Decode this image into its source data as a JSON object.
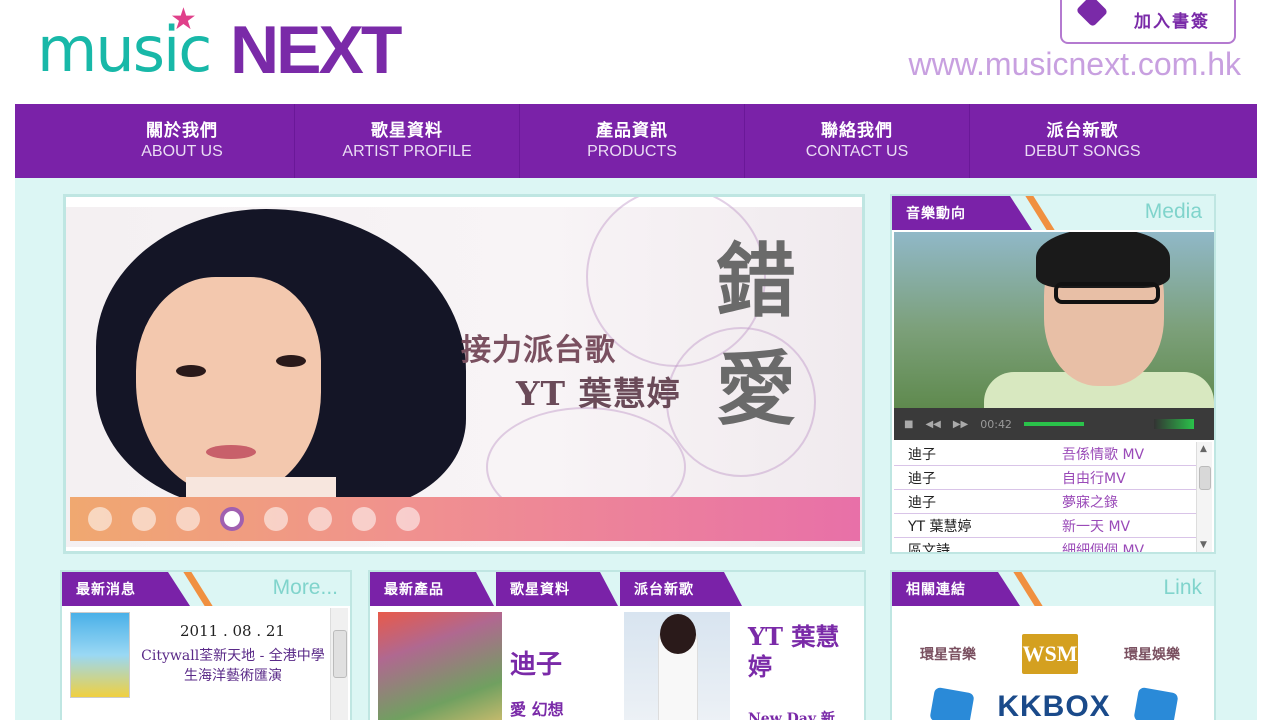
{
  "header": {
    "logo_music": "music",
    "logo_next": "NEXT",
    "bookmark_label": "加入書簽",
    "url": "www.musicnext.com.hk"
  },
  "nav": [
    {
      "zh": "關於我們",
      "en": "ABOUT US"
    },
    {
      "zh": "歌星資料",
      "en": "ARTIST PROFILE"
    },
    {
      "zh": "產品資訊",
      "en": "PRODUCTS"
    },
    {
      "zh": "聯絡我們",
      "en": "CONTACT US"
    },
    {
      "zh": "派台新歌",
      "en": "DEBUT SONGS"
    }
  ],
  "banner": {
    "line1": "接力派台歌",
    "line2": "YT 葉慧婷",
    "title": "錯愛",
    "slide_count": 8,
    "active_slide": 4
  },
  "media": {
    "tab": "音樂動向",
    "en": "Media",
    "player_time": "00:42",
    "playlist": [
      {
        "artist": "迪子",
        "song": "吾係情歌 MV"
      },
      {
        "artist": "迪子",
        "song": "自由行MV"
      },
      {
        "artist": "迪子",
        "song": "夢寐之錄"
      },
      {
        "artist": "YT 葉慧婷",
        "song": "新一天 MV"
      },
      {
        "artist": "區文詩",
        "song": "細細個個 MV"
      }
    ]
  },
  "news": {
    "tab": "最新消息",
    "en": "More...",
    "date": "2011 . 08 . 21",
    "text": "Citywall荃新天地 - 全港中學生海洋藝術匯演"
  },
  "products": {
    "tabs": [
      "最新產品",
      "歌星資料",
      "派台新歌"
    ],
    "item1_title": "迪子",
    "item1_sub": "愛 幻想",
    "item2_title": "YT 葉慧婷",
    "item2_sub": "New Day 新"
  },
  "links": {
    "tab": "相關連結",
    "en": "Link",
    "left_text": "環星音樂",
    "logo": "WSM",
    "right_text": "環星娛樂",
    "kkbox": "KKBOX"
  },
  "colors": {
    "accent": "#7a22a8",
    "teal": "#18b8a8",
    "bg": "#dcf6f4"
  }
}
